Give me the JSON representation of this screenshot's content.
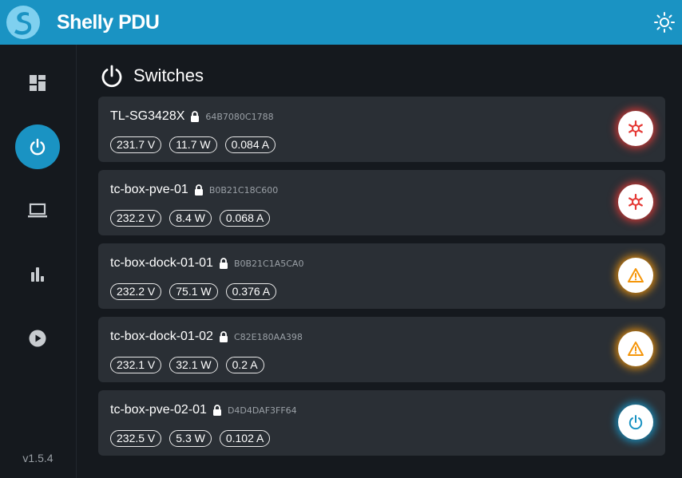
{
  "app": {
    "title": "Shelly PDU",
    "version": "v1.5.4",
    "accent": "#1a93c3"
  },
  "sidebar": {
    "items": [
      {
        "icon": "dashboard-icon",
        "active": false
      },
      {
        "icon": "power-icon",
        "active": true
      },
      {
        "icon": "laptop-icon",
        "active": false
      },
      {
        "icon": "bar-chart-icon",
        "active": false
      },
      {
        "icon": "play-circle-icon",
        "active": false
      }
    ]
  },
  "main": {
    "title": "Switches",
    "switches": [
      {
        "name": "TL-SG3428X",
        "id": "64B7080C1788",
        "voltage": "231.7 V",
        "power": "11.7 W",
        "current": "0.084 A",
        "status": "error",
        "status_color": "#e53935",
        "icon": "asterisk-icon"
      },
      {
        "name": "tc-box-pve-01",
        "id": "B0B21C18C600",
        "voltage": "232.2 V",
        "power": "8.4 W",
        "current": "0.068 A",
        "status": "error",
        "status_color": "#e53935",
        "icon": "asterisk-icon"
      },
      {
        "name": "tc-box-dock-01-01",
        "id": "B0B21C1A5CA0",
        "voltage": "232.2 V",
        "power": "75.1 W",
        "current": "0.376 A",
        "status": "warning",
        "status_color": "#f5960a",
        "icon": "warning-icon"
      },
      {
        "name": "tc-box-dock-01-02",
        "id": "C82E180AA398",
        "voltage": "232.1 V",
        "power": "32.1 W",
        "current": "0.2 A",
        "status": "warning",
        "status_color": "#f5960a",
        "icon": "warning-icon"
      },
      {
        "name": "tc-box-pve-02-01",
        "id": "D4D4DAF3FF64",
        "voltage": "232.5 V",
        "power": "5.3 W",
        "current": "0.102 A",
        "status": "ok",
        "status_color": "#1a93c3",
        "icon": "power-icon"
      }
    ]
  }
}
